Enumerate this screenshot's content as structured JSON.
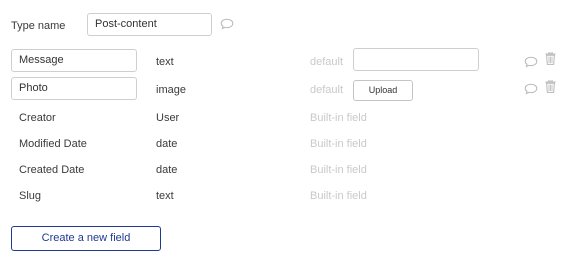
{
  "type_name": {
    "label": "Type name",
    "value": "Post-content"
  },
  "fields": [
    {
      "name": "Message",
      "type": "text",
      "default_label": "default"
    },
    {
      "name": "Photo",
      "type": "image",
      "default_label": "default",
      "upload_label": "Upload"
    },
    {
      "name": "Creator",
      "type": "User",
      "note": "Built-in field"
    },
    {
      "name": "Modified Date",
      "type": "date",
      "note": "Built-in field"
    },
    {
      "name": "Created Date",
      "type": "date",
      "note": "Built-in field"
    },
    {
      "name": "Slug",
      "type": "text",
      "note": "Built-in field"
    }
  ],
  "create_button": {
    "label": "Create a new field"
  },
  "icons": {
    "comment": "speech-bubble-icon",
    "delete": "trash-icon"
  },
  "colors": {
    "accent": "#1f3b8f",
    "muted": "#c9c9c9",
    "icon": "#b8b8b8"
  }
}
